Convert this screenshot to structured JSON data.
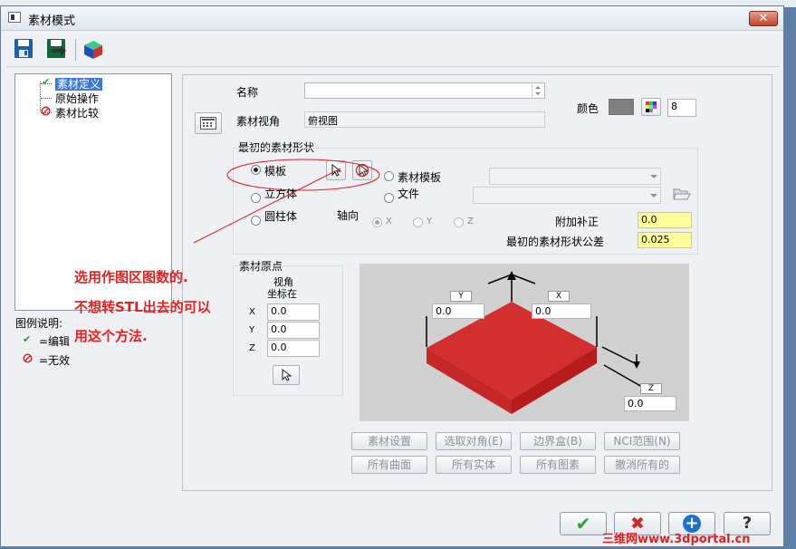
{
  "window": {
    "title": "素材模式",
    "close_label": "✕"
  },
  "toolbar": {
    "icons": [
      "save-icon",
      "import-icon",
      "solid-box-icon"
    ]
  },
  "tree": {
    "items": [
      {
        "label": "素材定义",
        "state": "edit"
      },
      {
        "label": "原始操作",
        "state": "none"
      },
      {
        "label": "素材比较",
        "state": "invalid"
      }
    ]
  },
  "legend": {
    "title": "图例说明:",
    "edit": "=编辑",
    "invalid": "=无效"
  },
  "form": {
    "name_label": "名称",
    "name_value": "",
    "stock_view_label": "素材视角",
    "stock_view_value": "俯视图",
    "color_label": "颜色",
    "color_value": "#808080",
    "color_number": "8"
  },
  "shape": {
    "group_title": "最初的素材形状",
    "template_label": "模板",
    "stock_template_label": "素材模板",
    "cube_label": "立方体",
    "file_label": "文件",
    "cylinder_label": "圆柱体",
    "axis_label": "轴向",
    "axis_x": "X",
    "axis_y": "Y",
    "axis_z": "Z",
    "extra_offset_label": "附加补正",
    "extra_offset_value": "0.0",
    "tolerance_label": "最初的素材形状公差",
    "tolerance_value": "0.025"
  },
  "origin": {
    "group_title": "素材原点",
    "view_label_1": "视角",
    "view_label_2": "坐标在",
    "x_label": "X",
    "x_value": "0.0",
    "y_label": "Y",
    "y_value": "0.0",
    "z_label": "Z",
    "z_value": "0.0"
  },
  "preview": {
    "y_label": "Y",
    "y_value": "0.0",
    "x_label": "X",
    "x_value": "0.0",
    "z_label": "Z",
    "z_value": "0.0",
    "box_color": "#d32f2f"
  },
  "buttons": {
    "stock_setup": "素材设置",
    "select_corner": "选取对角(E)",
    "bounding_box": "边界盒(B)",
    "nci_range": "NCI范围(N)",
    "all_surfaces": "所有曲面",
    "all_solids": "所有实体",
    "all_entities": "所有图素",
    "cancel_all": "撤消所有的"
  },
  "dialog_buttons": {
    "ok": "✔",
    "cancel": "✖",
    "add": "+",
    "help": "?"
  },
  "annotation": {
    "line1": "选用作图区图数的.",
    "line2": "不想转STL出去的可以",
    "line3": "用这个方法."
  },
  "watermark": "三维网www.3dportal.cn"
}
